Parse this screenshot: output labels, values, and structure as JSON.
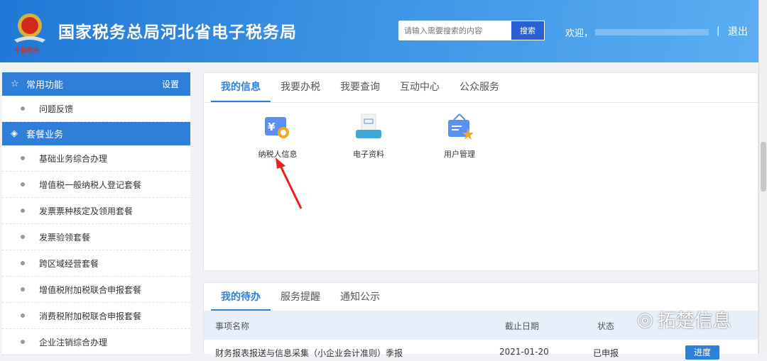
{
  "header": {
    "title": "国家税务总局河北省电子税务局",
    "search_placeholder": "请输入需要搜索的内容",
    "search_button": "搜索",
    "welcome": "欢迎，",
    "separator": "|",
    "logout": "退出"
  },
  "sidebar": {
    "common": {
      "label": "常用功能",
      "settings": "设置",
      "items": [
        "问题反馈"
      ]
    },
    "packages": {
      "label": "套餐业务",
      "items": [
        "基础业务综合办理",
        "增值税一般纳税人登记套餐",
        "发票票种核定及领用套餐",
        "发票验领套餐",
        "跨区域经营套餐",
        "增值税附加税联合申报套餐",
        "消费税附加税联合申报套餐",
        "企业注销综合办理"
      ]
    }
  },
  "main": {
    "tabs": [
      "我的信息",
      "我要办税",
      "我要查询",
      "互动中心",
      "公众服务"
    ],
    "icons": [
      {
        "label": "纳税人信息",
        "icon": "taxpayer-info-icon"
      },
      {
        "label": "电子资料",
        "icon": "electronic-docs-icon"
      },
      {
        "label": "用户管理",
        "icon": "user-management-icon"
      }
    ]
  },
  "todo": {
    "tabs": [
      "我的待办",
      "服务提醒",
      "通知公示"
    ],
    "columns": [
      "事项名称",
      "截止日期",
      "状态"
    ],
    "rows": [
      {
        "name": "财务报表报送与信息采集（小企业会计准则）季报",
        "date": "2021-01-20",
        "status": "已申报",
        "action": "进度"
      }
    ]
  },
  "watermark": "拓楚信息",
  "colors": {
    "primary": "#2f7fd8",
    "header": "#3b92e4",
    "arrow": "#e8221b"
  }
}
